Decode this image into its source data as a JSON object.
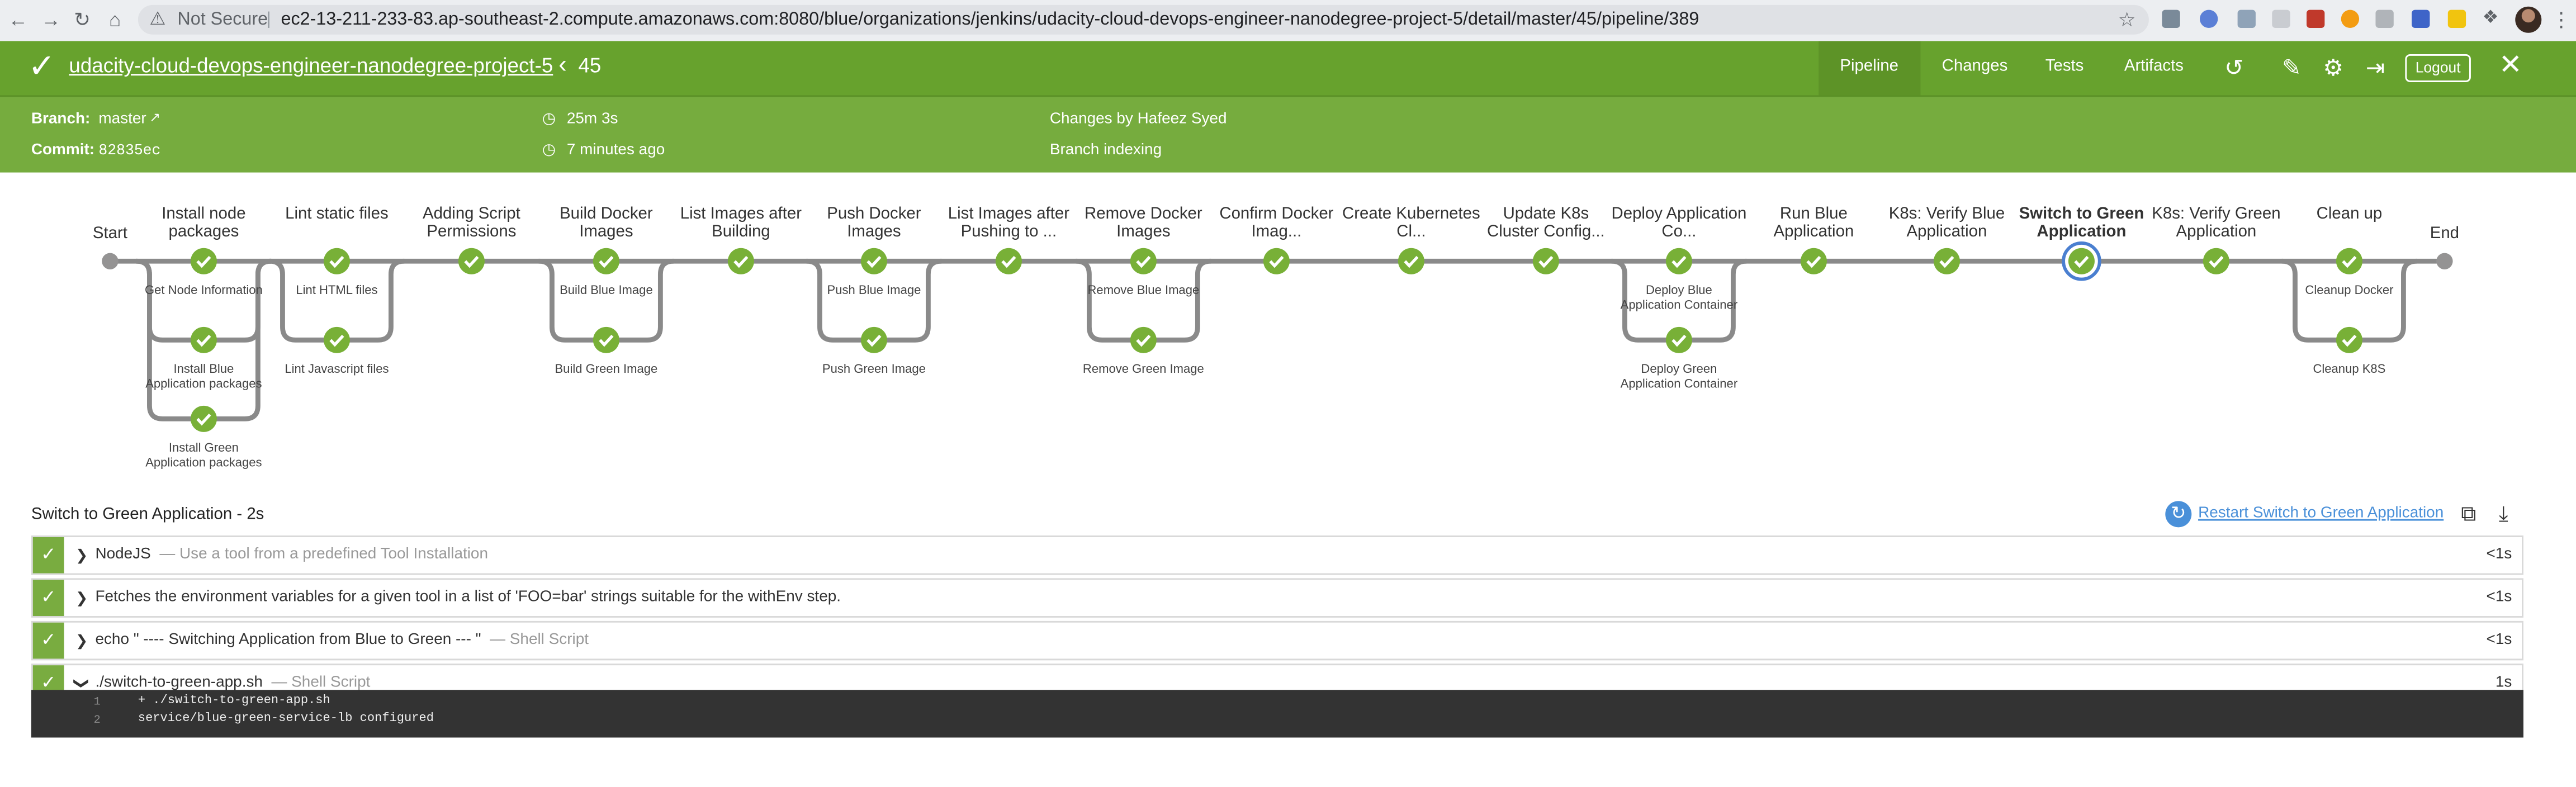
{
  "browser": {
    "security_label": "Not Secure",
    "url": "ec2-13-211-233-83.ap-southeast-2.compute.amazonaws.com:8080/blue/organizations/jenkins/udacity-cloud-devops-engineer-nanodegree-project-5/detail/master/45/pipeline/389"
  },
  "header": {
    "title": "udacity-cloud-devops-engineer-nanodegree-project-5",
    "run_number": "45",
    "tabs": [
      "Pipeline",
      "Changes",
      "Tests",
      "Artifacts"
    ],
    "active_tab": "Pipeline",
    "logout_label": "Logout",
    "accent_color": "#67a22d"
  },
  "meta": {
    "branch_label": "Branch:",
    "branch_value": "master",
    "commit_label": "Commit:",
    "commit_value": "82835ec",
    "duration": "25m 3s",
    "time_ago": "7 minutes ago",
    "changes_by": "Changes by Hafeez Syed",
    "cause": "Branch indexing"
  },
  "pipeline": {
    "start_label": "Start",
    "end_label": "End",
    "stages": [
      {
        "label": "Install node packages",
        "subs": [
          "Get Node Information",
          "Install Blue Application packages",
          "Install Green Application packages"
        ]
      },
      {
        "label": "Lint static files",
        "subs": [
          "Lint HTML files",
          "Lint Javascript files"
        ]
      },
      {
        "label": "Adding Script Permissions",
        "subs": []
      },
      {
        "label": "Build Docker Images",
        "subs": [
          "Build Blue Image",
          "Build Green Image"
        ]
      },
      {
        "label": "List Images after Building",
        "subs": []
      },
      {
        "label": "Push Docker Images",
        "subs": [
          "Push Blue Image",
          "Push Green Image"
        ]
      },
      {
        "label": "List Images after Pushing to ...",
        "subs": []
      },
      {
        "label": "Remove Docker Images",
        "subs": [
          "Remove Blue Image",
          "Remove Green Image"
        ]
      },
      {
        "label": "Confirm Docker Imag...",
        "subs": []
      },
      {
        "label": "Create Kubernetes Cl...",
        "subs": []
      },
      {
        "label": "Update K8s Cluster Config...",
        "subs": []
      },
      {
        "label": "Deploy Application Co...",
        "subs": [
          "Deploy Blue Application Container",
          "Deploy Green Application Container"
        ]
      },
      {
        "label": "Run Blue Application",
        "subs": []
      },
      {
        "label": "K8s: Verify Blue Application",
        "subs": []
      },
      {
        "label": "Switch to Green Application",
        "subs": [],
        "selected": true
      },
      {
        "label": "K8s: Verify Green Application",
        "subs": []
      },
      {
        "label": "Clean up",
        "subs": [
          "Cleanup Docker",
          "Cleanup K8S"
        ]
      }
    ],
    "status_color": "#78b037"
  },
  "stage_detail": {
    "title": "Switch to Green Application - 2s",
    "restart_label": "Restart Switch to Green Application",
    "steps": [
      {
        "name": "NodeJS",
        "desc": "— Use a tool from a predefined Tool Installation",
        "duration": "<1s",
        "expanded": false
      },
      {
        "name": "Fetches the environment variables for a given tool in a list of 'FOO=bar' strings suitable for the withEnv step.",
        "desc": "",
        "duration": "<1s",
        "expanded": false
      },
      {
        "name": "echo \" ---- Switching Application from Blue to Green --- \"",
        "desc": "— Shell Script",
        "duration": "<1s",
        "expanded": false
      },
      {
        "name": "./switch-to-green-app.sh",
        "desc": "— Shell Script",
        "duration": "1s",
        "expanded": true
      }
    ],
    "log": [
      {
        "num": "1",
        "text": "+ ./switch-to-green-app.sh"
      },
      {
        "num": "2",
        "text": "service/blue-green-service-lb configured"
      }
    ]
  }
}
